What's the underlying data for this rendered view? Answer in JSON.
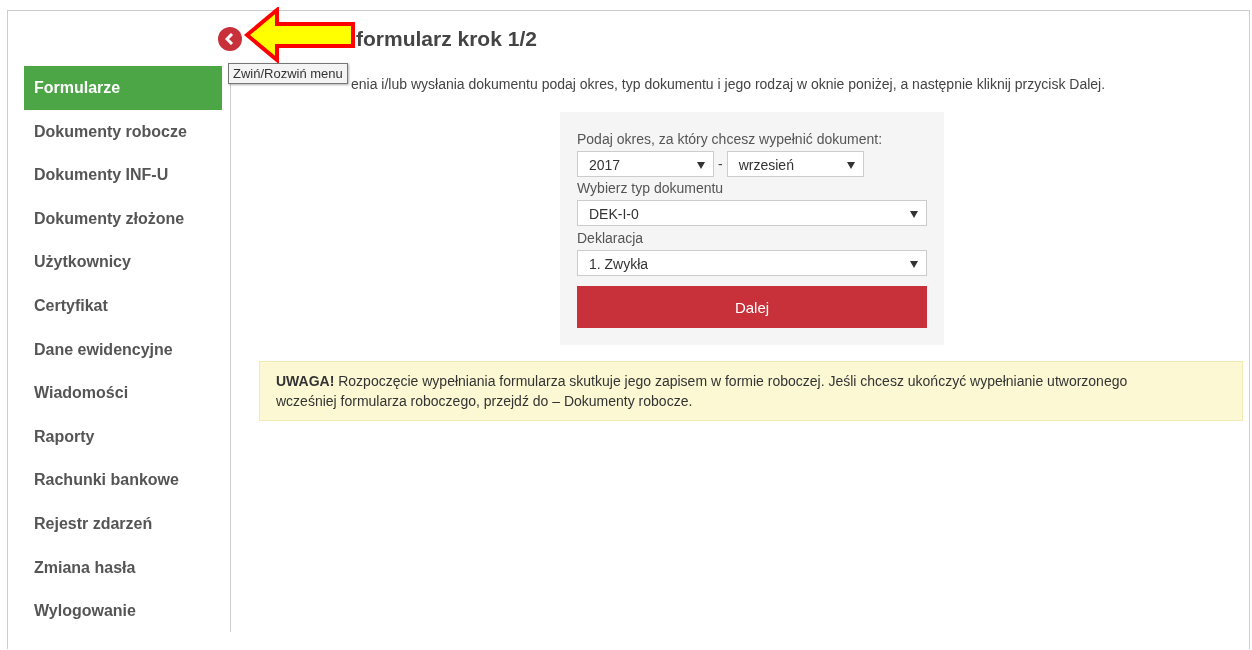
{
  "collapse_button": {
    "tooltip": "Zwiń/Rozwiń menu"
  },
  "sidebar": {
    "items": [
      {
        "label": "Formularze",
        "selected": true
      },
      {
        "label": "Dokumenty robocze",
        "selected": false
      },
      {
        "label": "Dokumenty INF-U",
        "selected": false
      },
      {
        "label": "Dokumenty złożone",
        "selected": false
      },
      {
        "label": "Użytkownicy",
        "selected": false
      },
      {
        "label": "Certyfikat",
        "selected": false
      },
      {
        "label": "Dane ewidencyjne",
        "selected": false
      },
      {
        "label": "Wiadomości",
        "selected": false
      },
      {
        "label": "Raporty",
        "selected": false
      },
      {
        "label": "Rachunki bankowe",
        "selected": false
      },
      {
        "label": "Rejestr zdarzeń",
        "selected": false
      },
      {
        "label": "Zmiana hasła",
        "selected": false
      },
      {
        "label": "Wylogowanie",
        "selected": false
      }
    ]
  },
  "page_title": "formularz krok 1/2",
  "intro": "enia i/lub wysłania dokumentu podaj okres, typ dokumentu i jego rodzaj w oknie poniżej, a następnie kliknij przycisk Dalej.",
  "form": {
    "period_label": "Podaj okres, za który chcesz wypełnić dokument:",
    "year": "2017",
    "separator": "-",
    "month": "wrzesień",
    "type_label": "Wybierz typ dokumentu",
    "type": "DEK-I-0",
    "declaration_label": "Deklaracja",
    "declaration": "1. Zwykła",
    "button": "Dalej"
  },
  "notice": "**UWAGA!** Rozpoczęcie wypełniania formularza skutkuje jego zapisem w formie roboczej. Jeśli chcesz ukończyć wypełnianie utworzonego wcześniej formularza roboczego, przejdź do – Dokumenty robocze."
}
